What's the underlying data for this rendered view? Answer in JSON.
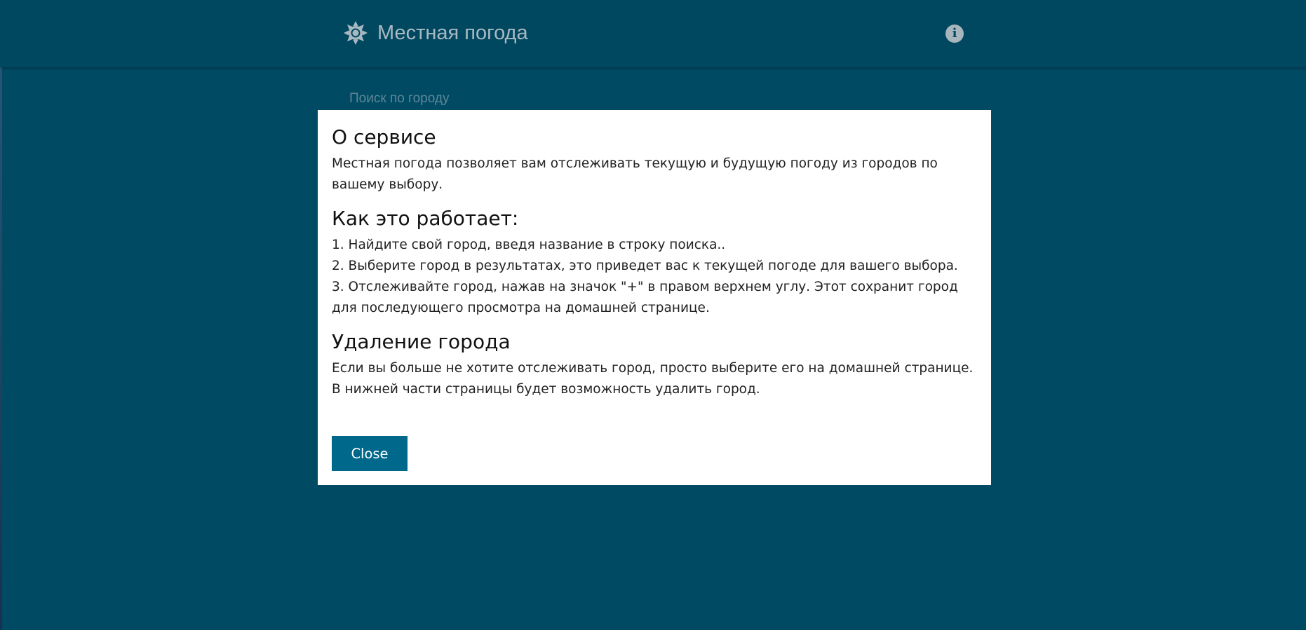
{
  "header": {
    "title": "Местная погода",
    "logo_icon": "sun-icon",
    "info_icon": "info-icon",
    "info_glyph": "i"
  },
  "search": {
    "label": "Поиск по городу"
  },
  "modal": {
    "sections": [
      {
        "heading": "О сервисе",
        "lines": [
          "Местная погода позволяет вам отслеживать текущую и будущую погоду из городов по вашему выбору."
        ]
      },
      {
        "heading": "Как это работает:",
        "lines": [
          "1. Найдите свой город, введя название в строку поиска..",
          "2. Выберите город в результатах, это приведет вас к текущей погоде для вашего выбора.",
          "3. Отслеживайте город, нажав на значок \"+\" в правом верхнем углу. Этот сохранит город для последующего просмотра на домашней странице."
        ]
      },
      {
        "heading": "Удаление города",
        "lines": [
          "Если вы больше не хотите отслеживать город, просто выберите его на домашней странице. В нижней части страницы будет возможность удалить город."
        ]
      }
    ],
    "close_label": "Close"
  },
  "colors": {
    "background": "#004a63",
    "header": "#004760",
    "button": "#00688b"
  }
}
